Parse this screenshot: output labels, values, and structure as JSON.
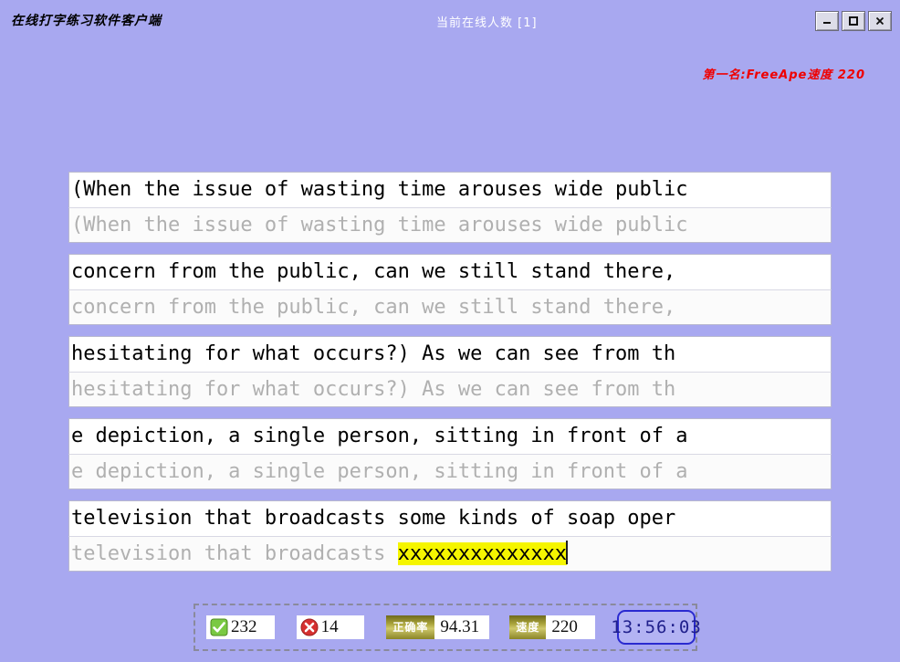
{
  "window": {
    "title": "在线打字练习软件客户端",
    "online_count_label": "当前在线人数 [1]",
    "buttons": {
      "minimize": "minimize-icon",
      "maximize": "maximize-icon",
      "close": "close-icon"
    },
    "background_color": "#a8a8f0"
  },
  "champion": {
    "text": "第一名:FreeApe速度 220",
    "color": "#ef0000"
  },
  "typing": {
    "lines": [
      {
        "reference": "(When the issue of wasting time arouses wide public",
        "typed_plain": "(When the issue of wasting time arouses wide public",
        "typed_highlight": "",
        "caret": false
      },
      {
        "reference": "concern from the public, can we still stand there,",
        "typed_plain": "concern from the public, can we still stand there,",
        "typed_highlight": "",
        "caret": false
      },
      {
        "reference": "hesitating for what occurs?) As we can see from th",
        "typed_plain": "hesitating for what occurs?) As we can see from th",
        "typed_highlight": "",
        "caret": false
      },
      {
        "reference": "e depiction, a single person, sitting in front of a",
        "typed_plain": "e depiction, a single person, sitting in front of a",
        "typed_highlight": "",
        "caret": false
      },
      {
        "reference": "television that broadcasts some kinds of soap oper",
        "typed_plain": "television that broadcasts ",
        "typed_highlight": "xxxxxxxxxxxxxx",
        "caret": true
      }
    ],
    "highlight_color": "#f5f500"
  },
  "status": {
    "correct_icon": "check-icon",
    "correct_count": "232",
    "wrong_icon": "cross-icon",
    "wrong_count": "14",
    "accuracy_label": "正确率",
    "accuracy_value": "94.31",
    "speed_label": "速度",
    "speed_value": "220",
    "clock": "13:56:03"
  }
}
